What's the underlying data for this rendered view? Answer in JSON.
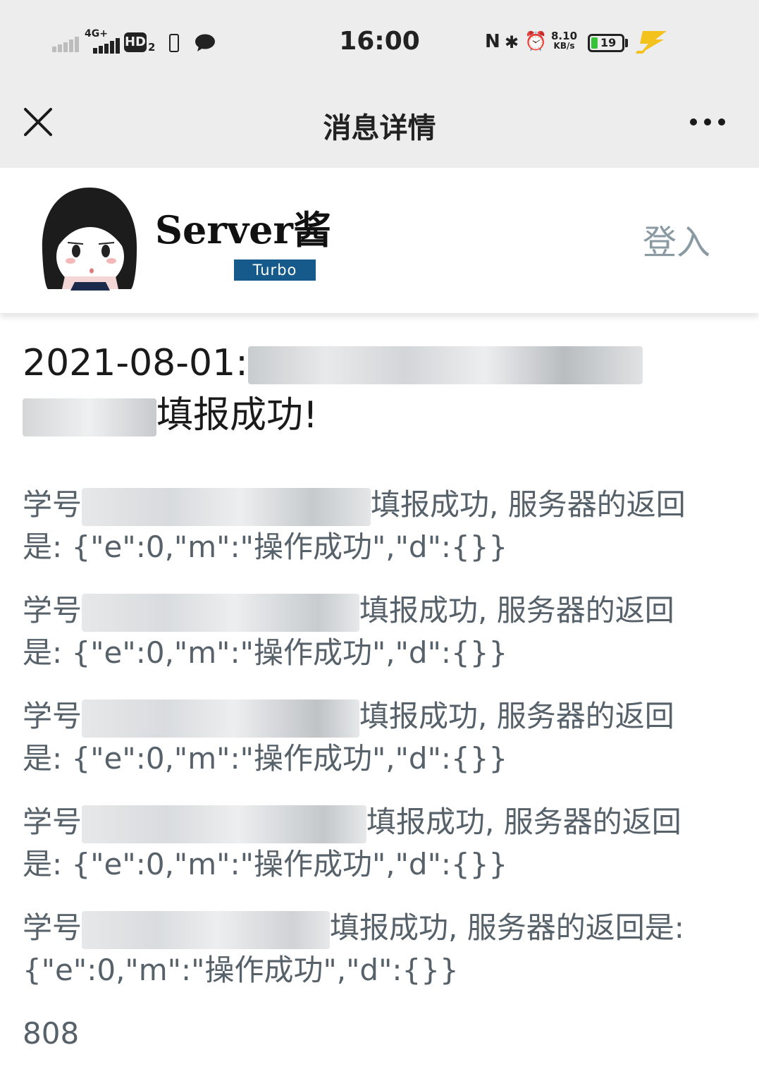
{
  "status_bar": {
    "time": "16:00",
    "network": "4G+",
    "hd_label": "HD",
    "hd_sub": "2",
    "nfc_glyph": "N",
    "bluetooth_glyph": "✱",
    "alarm_glyph": "⏰",
    "net_speed_value": "8.10",
    "net_speed_unit": "KB/s",
    "battery": "19",
    "icons": [
      "signal-icon",
      "hd-icon",
      "phone-icon",
      "chat-bubble-icon",
      "nfc-icon",
      "bluetooth-icon",
      "alarm-icon",
      "battery-icon",
      "charging-icon"
    ]
  },
  "header": {
    "title": "消息详情",
    "close_icon": "close-icon",
    "more_icon": "more-icon"
  },
  "account": {
    "name": "Server酱",
    "badge": "Turbo",
    "login": "登入"
  },
  "message": {
    "title_prefix": "2021-08-01:",
    "title_suffix": "填报成功!",
    "entries": [
      {
        "prefix": "学号",
        "middle": "填报成功, 服务器的返回",
        "tail": "是: {\"e\":0,\"m\":\"操作成功\",\"d\":{}}"
      },
      {
        "prefix": "学号",
        "middle": "填报成功, 服务器的返回",
        "tail": "是: {\"e\":0,\"m\":\"操作成功\",\"d\":{}}"
      },
      {
        "prefix": "学号",
        "middle": "填报成功, 服务器的返回",
        "tail": "是: {\"e\":0,\"m\":\"操作成功\",\"d\":{}}"
      },
      {
        "prefix": "学号",
        "middle": "填报成功, 服务器的返回",
        "tail": "是: {\"e\":0,\"m\":\"操作成功\",\"d\":{}}"
      },
      {
        "prefix": "学号",
        "middle": "填报成功, 服务器的返回是:",
        "tail": "{\"e\":0,\"m\":\"操作成功\",\"d\":{}}"
      }
    ],
    "footer_number": "808"
  }
}
